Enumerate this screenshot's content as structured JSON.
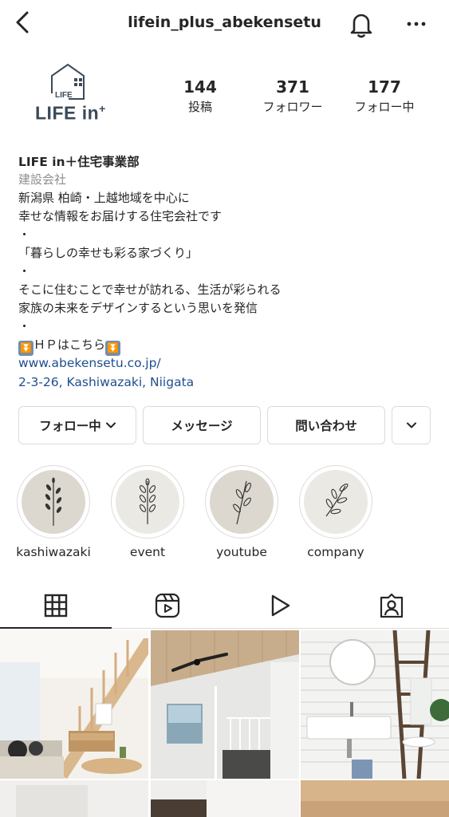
{
  "header": {
    "username": "lifein_plus_abekensetu"
  },
  "profile": {
    "logo_text": "LIFE in",
    "logo_plus": "+",
    "logo_small": "LIFE",
    "stats": [
      {
        "value": "144",
        "label": "投稿"
      },
      {
        "value": "371",
        "label": "フォロワー"
      },
      {
        "value": "177",
        "label": "フォロー中"
      }
    ]
  },
  "bio": {
    "name": "LIFE in＋住宅事業部",
    "category": "建設会社",
    "lines": [
      "新潟県 柏崎・上越地域を中心に",
      "幸せな情報をお届けする住宅会社です",
      "・",
      "「暮らしの幸せも彩る家づくり」",
      "・",
      "そこに住むことで幸せが訪れる、生活が彩られる",
      "家族の未来をデザインするという思いを発信",
      "・"
    ],
    "hp_line": "ＨＰはこちら",
    "hp_emoji": "⏬",
    "link": "www.abekensetu.co.jp/",
    "address": "2-3-26, Kashiwazaki, Niigata"
  },
  "actions": {
    "following_label": "フォロー中",
    "message_label": "メッセージ",
    "contact_label": "問い合わせ"
  },
  "highlights": [
    {
      "label": "kashiwazaki"
    },
    {
      "label": "event"
    },
    {
      "label": "youtube"
    },
    {
      "label": "company"
    }
  ],
  "tabs": [
    "grid-icon",
    "reels-icon",
    "play-icon",
    "tagged-icon"
  ],
  "colors": {
    "text": "#262626",
    "secondary": "#8e8e8e",
    "link": "#1f4e8d",
    "border": "#dbdbdb"
  }
}
